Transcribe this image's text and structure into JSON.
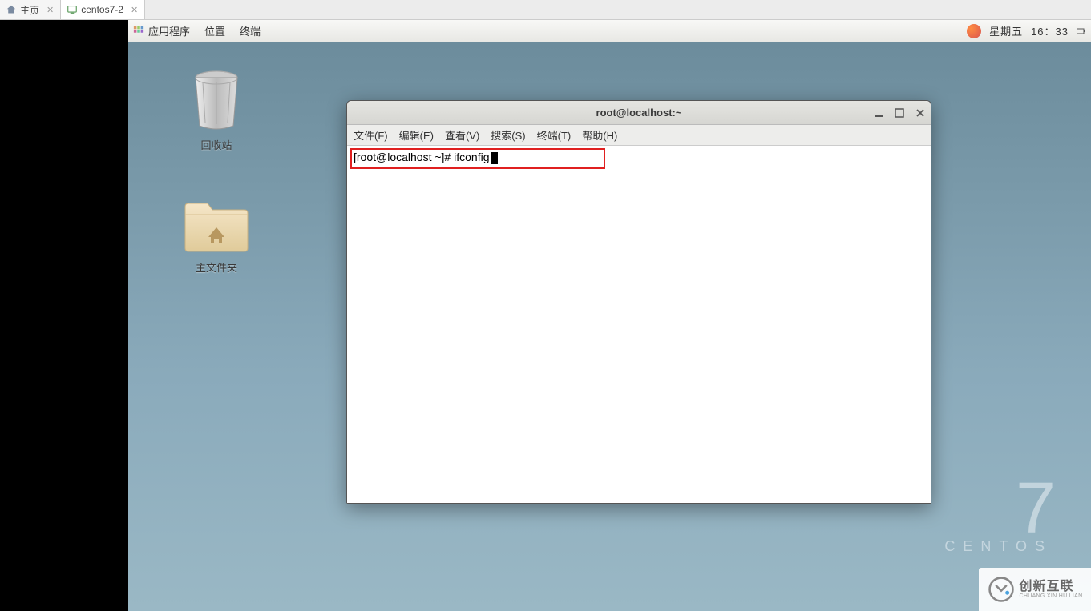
{
  "vmware_tabs": {
    "home": "主页",
    "vm_name": "centos7-2"
  },
  "gnome": {
    "apps": "应用程序",
    "places": "位置",
    "terminal": "终端",
    "day": "星期五",
    "time": "16：33"
  },
  "desktop": {
    "trash_label": "回收站",
    "home_folder_label": "主文件夹"
  },
  "centos": {
    "version": "7",
    "name": "CENTOS"
  },
  "terminal": {
    "title": "root@localhost:~",
    "menus": {
      "file": "文件(F)",
      "edit": "编辑(E)",
      "view": "查看(V)",
      "search": "搜索(S)",
      "terminal": "终端(T)",
      "help": "帮助(H)"
    },
    "prompt_prefix": "[root@localhost ~]# ",
    "command": "ifconfig"
  },
  "watermark": {
    "cn": "创新互联",
    "en": "CHUANG XIN HU LIAN"
  }
}
